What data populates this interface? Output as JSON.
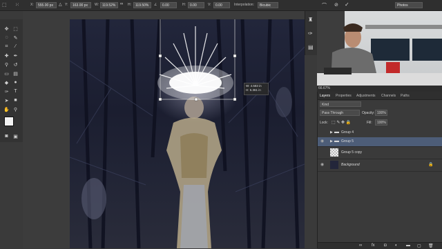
{
  "options_bar": {
    "x_label": "X:",
    "x_value": "555.00 px",
    "y_label": "Y:",
    "y_value": "163.00 px",
    "w_label": "W:",
    "w_value": "119.52%",
    "link_icon": "link-icon",
    "h_label": "H:",
    "h_value": "119.50%",
    "angle_label": "∠",
    "angle_value": "0.00",
    "h_skew_label": "H:",
    "h_skew_value": "0.00",
    "v_skew_label": "V:",
    "v_skew_value": "0.00",
    "interpolation_label": "Interpolation:",
    "interpolation_value": "Bicubic",
    "workspace_value": "Photos"
  },
  "transform_readout": {
    "w": "W: 4.583 in",
    "h": "H: 5.361 in"
  },
  "video": {
    "zoom": "66.67%"
  },
  "layers_panel": {
    "tabs": [
      "Layers",
      "Paths",
      "Adjustments",
      "Channels",
      "Paths"
    ],
    "kind_label": "Kind",
    "blend_mode": "Pass Through",
    "opacity_label": "Opacity:",
    "opacity_value": "100%",
    "lock_label": "Lock:",
    "fill_label": "Fill:",
    "fill_value": "100%",
    "layers": [
      {
        "name": "Group 4",
        "type": "group",
        "visible": false,
        "selected": false
      },
      {
        "name": "Group 5",
        "type": "group",
        "visible": true,
        "selected": true
      },
      {
        "name": "Group 5 copy",
        "type": "layer",
        "visible": false,
        "selected": false
      },
      {
        "name": "Background",
        "type": "background",
        "visible": true,
        "selected": false
      }
    ]
  }
}
